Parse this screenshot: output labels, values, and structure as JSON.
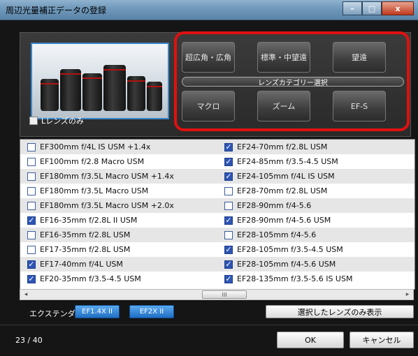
{
  "window": {
    "title": "周辺光量補正データの登録",
    "minimize": "–",
    "maximize": "□",
    "close": "x"
  },
  "filter": {
    "l_lens_only_label": "Lレンズのみ",
    "l_lens_only_checked": false
  },
  "categories": {
    "wide": "超広角・広角",
    "standard_mid": "標準・中望遠",
    "telephoto": "望遠",
    "bar_label": "レンズカテゴリー選択",
    "macro": "マクロ",
    "zoom": "ズーム",
    "efs": "EF-S"
  },
  "lenses": [
    {
      "left": {
        "name": "EF300mm f/4L IS USM +1.4x",
        "checked": false
      },
      "right": {
        "name": "EF24-70mm f/2.8L USM",
        "checked": true
      }
    },
    {
      "left": {
        "name": "EF100mm f/2.8 Macro USM",
        "checked": false
      },
      "right": {
        "name": "EF24-85mm f/3.5-4.5 USM",
        "checked": true
      }
    },
    {
      "left": {
        "name": "EF180mm f/3.5L Macro USM +1.4x",
        "checked": false
      },
      "right": {
        "name": "EF24-105mm f/4L IS USM",
        "checked": true
      }
    },
    {
      "left": {
        "name": "EF180mm f/3.5L Macro USM",
        "checked": false
      },
      "right": {
        "name": "EF28-70mm f/2.8L USM",
        "checked": false
      }
    },
    {
      "left": {
        "name": "EF180mm f/3.5L Macro USM +2.0x",
        "checked": false
      },
      "right": {
        "name": "EF28-90mm f/4-5.6",
        "checked": false
      }
    },
    {
      "left": {
        "name": "EF16-35mm f/2.8L II USM",
        "checked": true
      },
      "right": {
        "name": "EF28-90mm f/4-5.6 USM",
        "checked": true
      }
    },
    {
      "left": {
        "name": "EF16-35mm f/2.8L USM",
        "checked": false
      },
      "right": {
        "name": "EF28-105mm f/4-5.6",
        "checked": false
      }
    },
    {
      "left": {
        "name": "EF17-35mm f/2.8L USM",
        "checked": false
      },
      "right": {
        "name": "EF28-105mm f/3.5-4.5 USM",
        "checked": true
      }
    },
    {
      "left": {
        "name": "EF17-40mm f/4L USM",
        "checked": true
      },
      "right": {
        "name": "EF28-105mm f/4-5.6 USM",
        "checked": true
      }
    },
    {
      "left": {
        "name": "EF20-35mm f/3.5-4.5 USM",
        "checked": true
      },
      "right": {
        "name": "EF28-135mm f/3.5-5.6 IS USM",
        "checked": true
      }
    }
  ],
  "scrollbar": {
    "left_arrow": "◂",
    "right_arrow": "▸",
    "thumb_grip": "III"
  },
  "extender": {
    "label": "エクステンダー",
    "btn1": "EF1.4X II",
    "btn2": "EF2X II"
  },
  "show_selected_label": "選択したレンズのみ表示",
  "status": {
    "count": "23 / 40"
  },
  "ok_label": "OK",
  "cancel_label": "キャンセル",
  "colors": {
    "accent_blue": "#2e55b4",
    "highlight_red": "#e01010",
    "extender_blue": "#3a8ee0"
  }
}
